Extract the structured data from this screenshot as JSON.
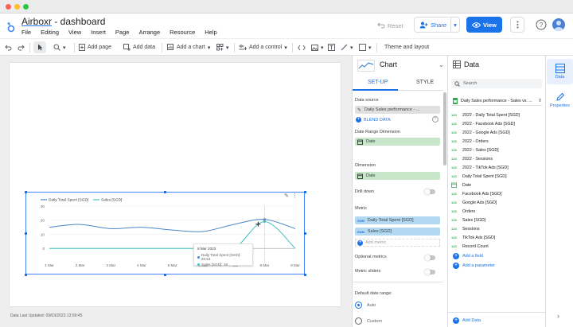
{
  "app": {
    "brand": "Airboxr",
    "title_suffix": " - dashboard",
    "menu": [
      "File",
      "Editing",
      "View",
      "Insert",
      "Page",
      "Arrange",
      "Resource",
      "Help"
    ],
    "reset_label": "Reset",
    "share_label": "Share",
    "view_label": "View"
  },
  "toolbar": {
    "add_page": "Add page",
    "add_data": "Add data",
    "add_chart": "Add a chart",
    "add_control": "Add a control",
    "theme_layout": "Theme and layout"
  },
  "canvas": {
    "data_updated": "Data Last Updated: 09/03/2023 13:59:45"
  },
  "chart_data": {
    "type": "line",
    "x": [
      "1 Mar",
      "2 Mar",
      "3 Mar",
      "4 Mar",
      "5 Mar",
      "6 Mar",
      "7 Mar",
      "8 Mar",
      "9 Mar"
    ],
    "series": [
      {
        "name": "Daily Total Spent [SGD]",
        "color": "#4a86c8",
        "values": [
          15,
          17,
          14,
          15,
          13,
          12,
          17,
          20.54,
          14
        ]
      },
      {
        "name": "Sales [SGD]",
        "color": "#45c1c1",
        "values": [
          0,
          0,
          0,
          0,
          0,
          0,
          0,
          19,
          0
        ]
      }
    ],
    "y_ticks": [
      0,
      10,
      20,
      30
    ],
    "ylim": [
      -10,
      30
    ],
    "legend": "top-left",
    "tooltip": {
      "date": "8 Mar 2023",
      "rows": [
        {
          "label": "Daily Total Spent [SGD]: 20.54",
          "color": "#4a86c8"
        },
        {
          "label": "Sales [SGD]: 19",
          "color": "#45c1c1"
        }
      ]
    }
  },
  "properties": {
    "title": "Chart",
    "tab_setup": "SET-UP",
    "tab_style": "STYLE",
    "data_source_label": "Data source",
    "data_source_value": "Daily Sales performance - ...",
    "blend_data": "BLEND DATA",
    "date_range_label": "Date Range Dimension",
    "date_range_value": "Date",
    "dimension_label": "Dimension",
    "dimension_value": "Date",
    "drill_down": "Drill down",
    "metric_label": "Metric",
    "sum_tag": "SUM",
    "metric_1": "Daily Total Spent [SGD]",
    "metric_2": "Sales [SGD]",
    "add_metric": "Add metric",
    "optional_metrics": "Optional metrics",
    "metric_sliders": "Metric sliders",
    "default_date_range": "Default date range:",
    "auto": "Auto",
    "custom": "Custom"
  },
  "data_panel": {
    "title": "Data",
    "search_placeholder": "Search",
    "source": "Daily Sales performance - Sales vs. ...",
    "fields": [
      {
        "type": "123",
        "name": "2022 - Daily Total Spent [SGD]"
      },
      {
        "type": "123",
        "name": "2022 - Facebook Ads [SGD]"
      },
      {
        "type": "123",
        "name": "2022 - Google Ads [SGD]"
      },
      {
        "type": "123",
        "name": "2022 - Orders"
      },
      {
        "type": "123",
        "name": "2022 - Sales [SGD]"
      },
      {
        "type": "123",
        "name": "2022 - Sessions"
      },
      {
        "type": "123",
        "name": "2022 - TikTok Ads [SGD]"
      },
      {
        "type": "123",
        "name": "Daily Total Spent [SGD]"
      },
      {
        "type": "cal",
        "name": "Date"
      },
      {
        "type": "123",
        "name": "Facebook Ads [SGD]"
      },
      {
        "type": "123",
        "name": "Google Ads [SGD]"
      },
      {
        "type": "123",
        "name": "Orders"
      },
      {
        "type": "123",
        "name": "Sales [SGD]"
      },
      {
        "type": "123",
        "name": "Sessions"
      },
      {
        "type": "123",
        "name": "TikTok Ads [SGD]"
      },
      {
        "type": "123",
        "name": "Record Count"
      }
    ],
    "add_field": "Add a field",
    "add_parameter": "Add a parameter",
    "add_data": "Add Data"
  },
  "rail": {
    "data": "Data",
    "properties": "Properties"
  }
}
